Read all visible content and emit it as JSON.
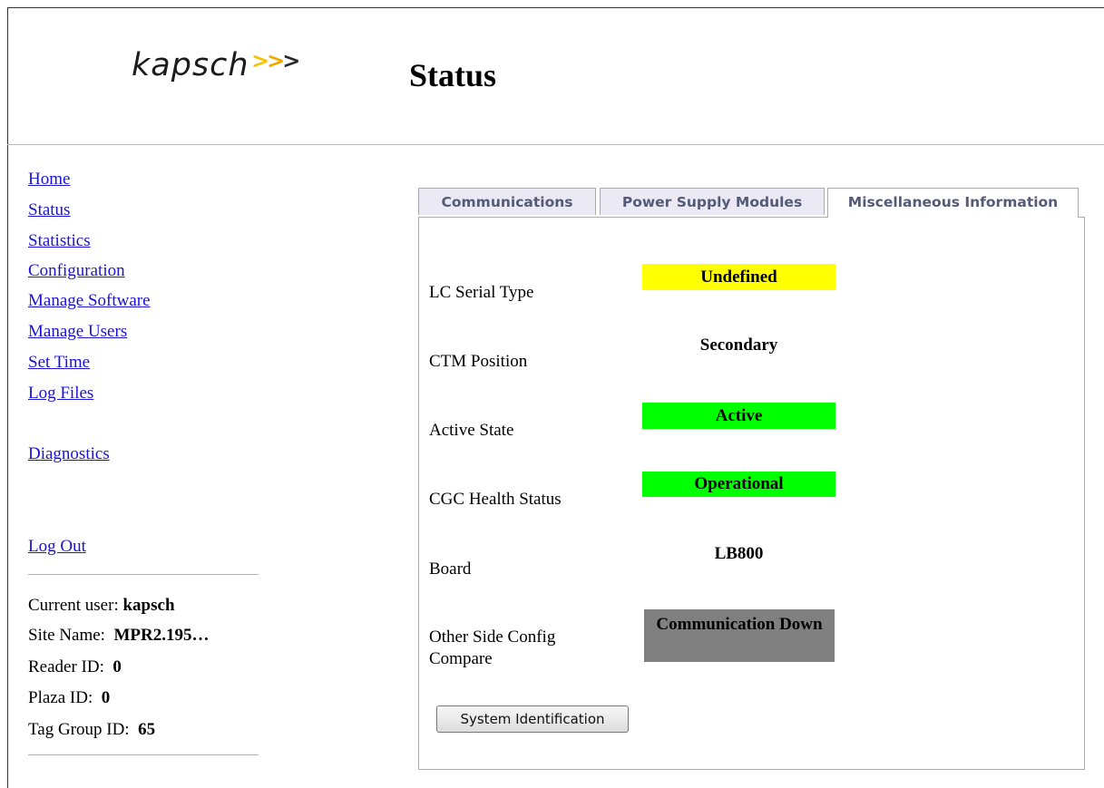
{
  "logo": {
    "text": "kapsch",
    "arrows": ">>>"
  },
  "page_title": "Status",
  "nav": {
    "items": [
      "Home",
      "Status",
      "Statistics",
      "Configuration",
      "Manage Software",
      "Manage Users",
      "Set Time",
      "Log Files"
    ],
    "diagnostics": "Diagnostics",
    "logout": "Log Out"
  },
  "session": {
    "current_user_label": "Current user:",
    "current_user": "kapsch",
    "site_name_label": "Site Name:",
    "site_name": "MPR2.195…",
    "reader_id_label": "Reader ID:",
    "reader_id": "0",
    "plaza_id_label": "Plaza ID:",
    "plaza_id": "0",
    "tag_group_label": "Tag Group ID:",
    "tag_group": "65"
  },
  "tabs": [
    "Communications",
    "Power Supply Modules",
    "Miscellaneous Information"
  ],
  "active_tab": "Miscellaneous Information",
  "misc": {
    "rows": [
      {
        "label": "LC Serial Type",
        "value": "Undefined",
        "color": "#ffff00"
      },
      {
        "label": "CTM Position",
        "value": "Secondary",
        "color": ""
      },
      {
        "label": "Active State",
        "value": "Active",
        "color": "#00ff00"
      },
      {
        "label": "CGC Health Status",
        "value": "Operational",
        "color": "#00ff00"
      },
      {
        "label": "Board",
        "value": "LB800",
        "color": ""
      },
      {
        "label": "Other Side Config Compare",
        "value": "Communication Down",
        "color": "#808080"
      }
    ]
  },
  "buttons": {
    "system_identification": "System Identification"
  }
}
